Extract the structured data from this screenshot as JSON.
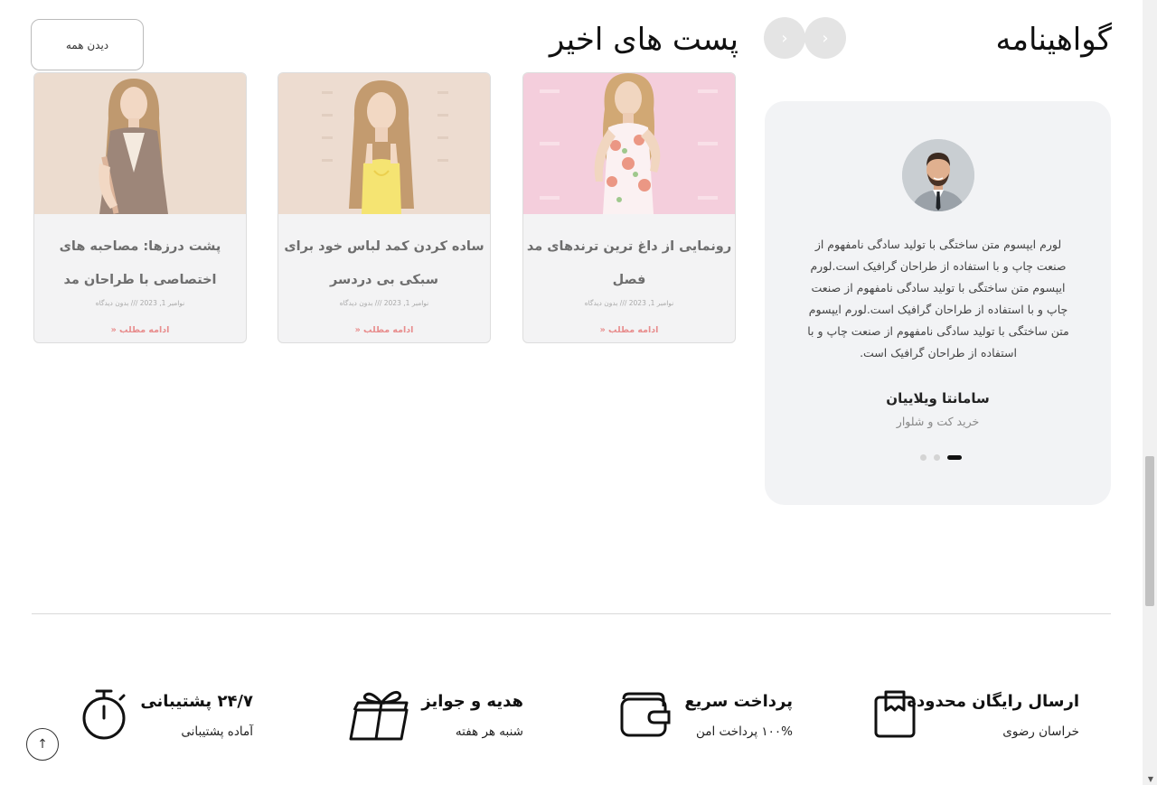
{
  "testimonials": {
    "title": "گواهینامه",
    "prev_label": "‹",
    "next_label": "‹",
    "text": "لورم ایپسوم متن ساختگی با تولید سادگی نامفهوم از صنعت چاپ و با استفاده از طراحان گرافیک است.لورم ایپسوم متن ساختگی با تولید سادگی نامفهوم از صنعت چاپ و با استفاده از طراحان گرافیک است.لورم ایپسوم متن ساختگی با تولید سادگی نامفهوم از صنعت چاپ و با استفاده از طراحان گرافیک است.",
    "name": "سامانتا ویلاییان",
    "role": "خرید کت و شلوار",
    "slides": 3,
    "active_slide": 1
  },
  "posts": {
    "title": "پست های اخیر",
    "view_all": "دیدن همه",
    "items": [
      {
        "title": "رونمایی از داغ ترین ترندهای مد فصل",
        "meta": "نوامبر 1, 2023 /// بدون دیدگاه",
        "more": "ادامه مطلب «"
      },
      {
        "title": "ساده کردن کمد لباس خود برای سبکی بی دردسر",
        "meta": "نوامبر 1, 2023 /// بدون دیدگاه",
        "more": "ادامه مطلب «"
      },
      {
        "title": "پشت درزها: مصاحبه های اختصاصی با طراحان مد",
        "meta": "نوامبر 1, 2023 /// بدون دیدگاه",
        "more": "ادامه مطلب «"
      }
    ]
  },
  "features": [
    {
      "title": "ارسال رایگان محدوده",
      "subtitle": "خراسان رضوی",
      "icon": "package-icon"
    },
    {
      "title": "پرداخت سریع",
      "subtitle": "۱۰۰% پرداخت امن",
      "icon": "wallet-icon"
    },
    {
      "title": "هدیه و جوایز",
      "subtitle": "شنبه هر هفته",
      "icon": "gift-icon"
    },
    {
      "title": "۲۴/۷ پشتیبانی",
      "subtitle": "آماده پشتیبانی",
      "icon": "stopwatch-icon"
    }
  ],
  "scroll_top_label": "↑"
}
